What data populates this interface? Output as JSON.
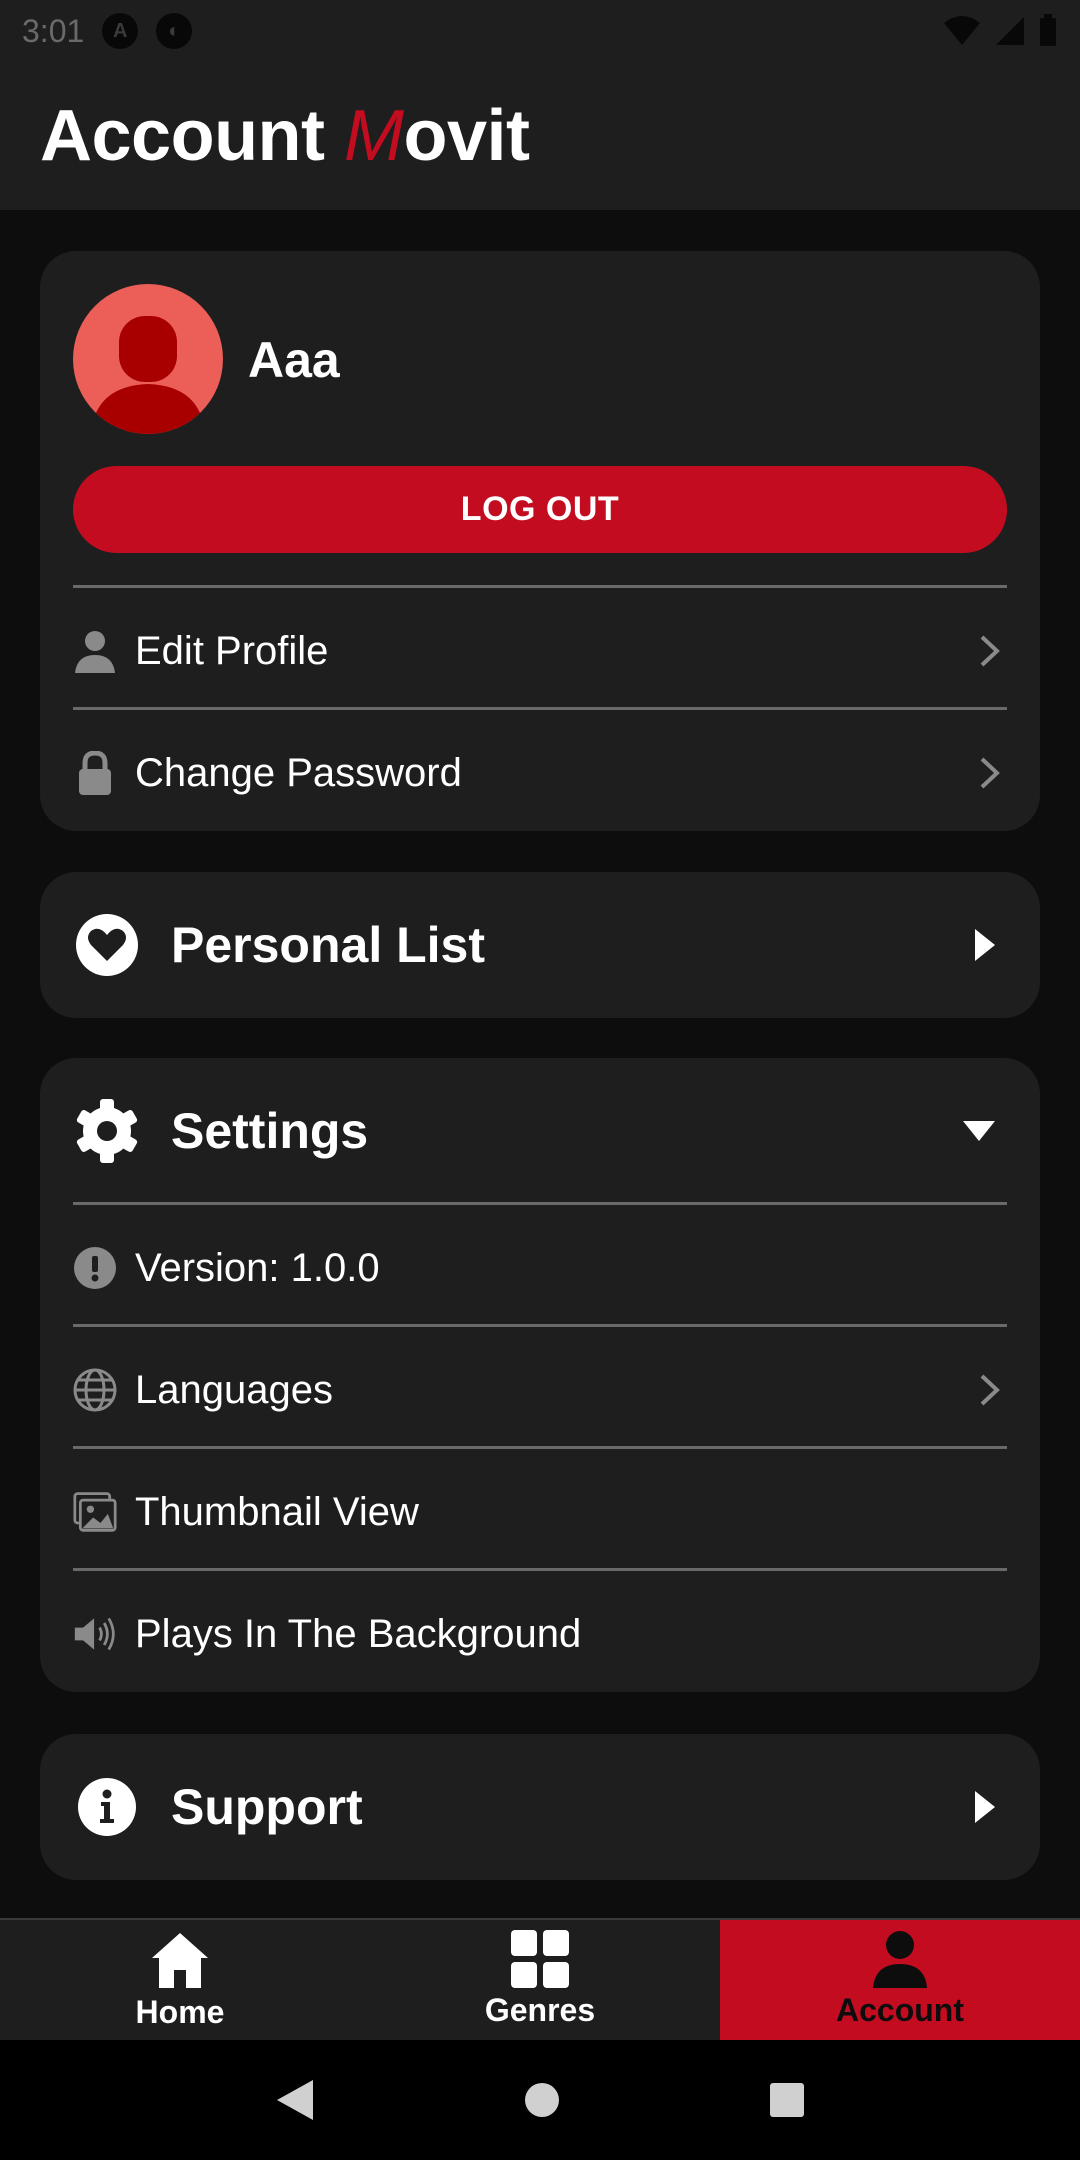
{
  "status_bar": {
    "time": "3:01"
  },
  "header": {
    "title_prefix": "Account ",
    "brand_m": "M",
    "brand_rest": "ovit"
  },
  "profile": {
    "name": "Aaa",
    "logout_label": "LOG OUT",
    "items": [
      {
        "label": "Edit Profile",
        "icon": "person-icon"
      },
      {
        "label": "Change Password",
        "icon": "lock-icon"
      }
    ]
  },
  "personal_list": {
    "label": "Personal List",
    "icon": "heart-icon"
  },
  "settings": {
    "label": "Settings",
    "icon": "gear-icon",
    "items": [
      {
        "label": "Version: 1.0.0",
        "icon": "info-exclamation-icon"
      },
      {
        "label": "Languages",
        "icon": "globe-icon"
      },
      {
        "label": "Thumbnail View",
        "icon": "image-icon"
      },
      {
        "label": "Plays In The Background",
        "icon": "speaker-icon"
      }
    ]
  },
  "support": {
    "label": "Support",
    "icon": "info-icon"
  },
  "bottom_nav": {
    "items": [
      {
        "label": "Home",
        "icon": "home-icon"
      },
      {
        "label": "Genres",
        "icon": "grid-icon"
      },
      {
        "label": "Account",
        "icon": "account-icon",
        "active": true
      }
    ]
  },
  "colors": {
    "accent": "#c40c20",
    "card": "#1e1e1e",
    "background": "#0d0d0d",
    "avatar": "#ec5e58",
    "icon_grey": "#8a8a8a"
  }
}
